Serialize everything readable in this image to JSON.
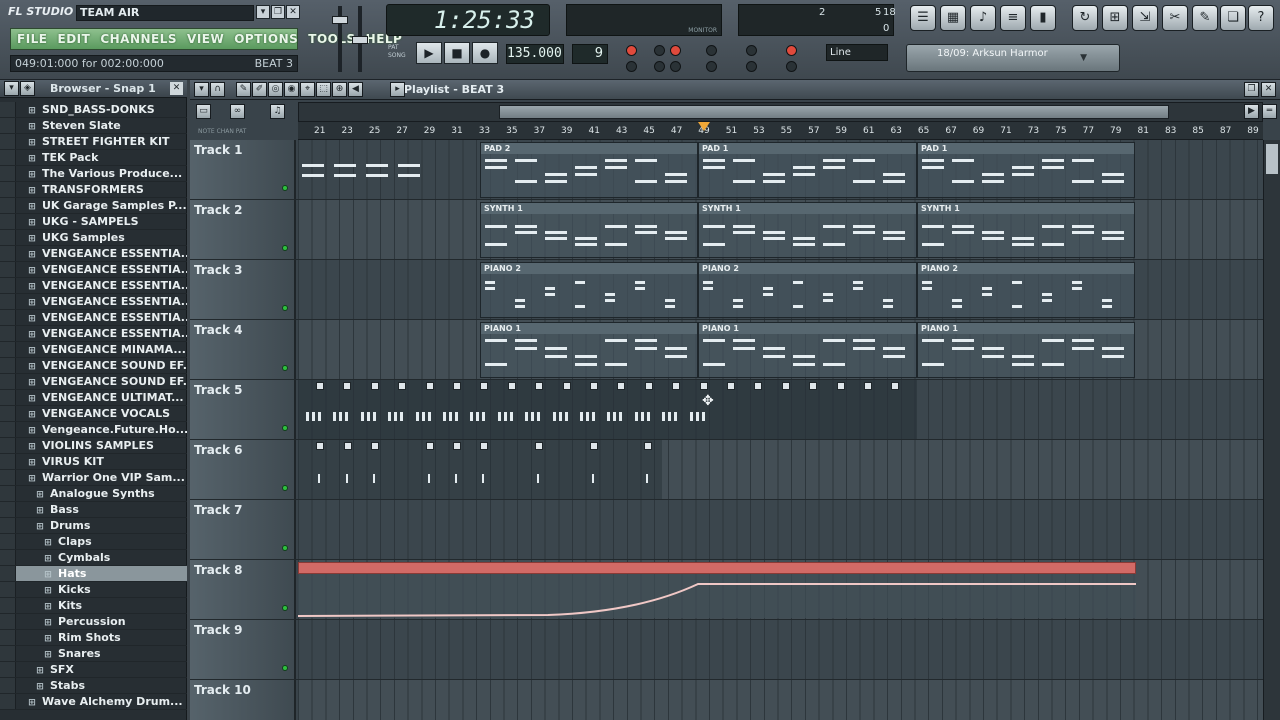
{
  "app": {
    "logo": "FL STUDIO",
    "project_title": "TEAM AIR",
    "hint": "049:01:000 for 002:00:000",
    "hint_pattern": "BEAT 3"
  },
  "menu": [
    "FILE",
    "EDIT",
    "CHANNELS",
    "VIEW",
    "OPTIONS",
    "TOOLS",
    "HELP"
  ],
  "transport": {
    "time": "1:25:33",
    "tempo": "135.000",
    "pattern": "9",
    "mode_pat": "PAT",
    "mode_song": "SONG",
    "snap": "Line",
    "monitor_label": "MONITOR",
    "cpu_values": [
      "2",
      "5",
      "18",
      "0"
    ],
    "song_info": "18/09: Arksun Harmor"
  },
  "browser": {
    "title": "Browser - Snap 1",
    "items": [
      {
        "label": "SND_BASS-DONKS",
        "indent": 0
      },
      {
        "label": "Steven Slate",
        "indent": 0
      },
      {
        "label": "STREET FIGHTER KIT",
        "indent": 0
      },
      {
        "label": "TEK Pack",
        "indent": 0
      },
      {
        "label": "The Various Produce...",
        "indent": 0
      },
      {
        "label": "TRANSFORMERS",
        "indent": 0
      },
      {
        "label": "UK Garage Samples P...",
        "indent": 0
      },
      {
        "label": "UKG - SAMPELS",
        "indent": 0
      },
      {
        "label": "UKG Samples",
        "indent": 0
      },
      {
        "label": "VENGEANCE ESSENTIA...",
        "indent": 0
      },
      {
        "label": "VENGEANCE ESSENTIA...",
        "indent": 0
      },
      {
        "label": "VENGEANCE ESSENTIA...",
        "indent": 0
      },
      {
        "label": "VENGEANCE ESSENTIA...",
        "indent": 0
      },
      {
        "label": "VENGEANCE ESSENTIA...",
        "indent": 0
      },
      {
        "label": "VENGEANCE ESSENTIA...",
        "indent": 0
      },
      {
        "label": "VENGEANCE MINAMA...",
        "indent": 0
      },
      {
        "label": "VENGEANCE SOUND EF...",
        "indent": 0
      },
      {
        "label": "VENGEANCE SOUND EF...",
        "indent": 0
      },
      {
        "label": "VENGEANCE ULTIMAT...",
        "indent": 0
      },
      {
        "label": "VENGEANCE VOCALS",
        "indent": 0
      },
      {
        "label": "Vengeance.Future.Ho...",
        "indent": 0
      },
      {
        "label": "VIOLINS SAMPLES",
        "indent": 0
      },
      {
        "label": "VIRUS KIT",
        "indent": 0
      },
      {
        "label": "Warrior One VIP Sam...",
        "indent": 0
      },
      {
        "label": "Analogue Synths",
        "indent": 1
      },
      {
        "label": "Bass",
        "indent": 1
      },
      {
        "label": "Drums",
        "indent": 1
      },
      {
        "label": "Claps",
        "indent": 2
      },
      {
        "label": "Cymbals",
        "indent": 2
      },
      {
        "label": "Hats",
        "indent": 2,
        "selected": true
      },
      {
        "label": "Kicks",
        "indent": 2
      },
      {
        "label": "Kits",
        "indent": 2
      },
      {
        "label": "Percussion",
        "indent": 2
      },
      {
        "label": "Rim Shots",
        "indent": 2
      },
      {
        "label": "Snares",
        "indent": 2
      },
      {
        "label": "SFX",
        "indent": 1
      },
      {
        "label": "Stabs",
        "indent": 1
      },
      {
        "label": "Wave Alchemy Drum...",
        "indent": 0
      }
    ]
  },
  "playlist": {
    "title": "Playlist - BEAT 3",
    "ruler_ticks": [
      "21",
      "23",
      "25",
      "27",
      "29",
      "31",
      "33",
      "35",
      "37",
      "39",
      "41",
      "43",
      "45",
      "47",
      "49",
      "51",
      "53",
      "55",
      "57",
      "59",
      "61",
      "63",
      "65",
      "67",
      "69",
      "71",
      "73",
      "75",
      "77",
      "79",
      "81",
      "83",
      "85",
      "87",
      "89"
    ],
    "small_labels": "NOTE  CHAN  PAT",
    "tracks": [
      "Track 1",
      "Track 2",
      "Track 3",
      "Track 4",
      "Track 5",
      "Track 6",
      "Track 7",
      "Track 8",
      "Track 9",
      "Track 10"
    ],
    "clips": {
      "track1": [
        "PAD 2",
        "PAD 1",
        "PAD 1"
      ],
      "track2": [
        "SYNTH 1",
        "SYNTH 1",
        "SYNTH 1"
      ],
      "track3": [
        "PIANO 2",
        "PIANO 2",
        "PIANO 2"
      ],
      "track4": [
        "PIANO 1",
        "PIANO 1",
        "PIANO 1"
      ]
    }
  }
}
